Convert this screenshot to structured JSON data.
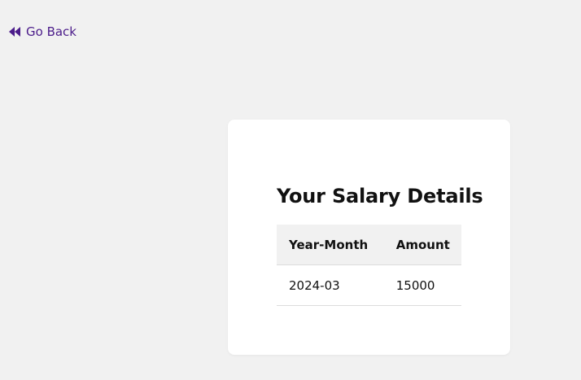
{
  "nav": {
    "go_back_label": "Go Back",
    "go_back_icon": "fast-rewind-icon"
  },
  "card": {
    "title": "Your Salary Details",
    "table": {
      "headers": [
        "Year-Month",
        "Amount"
      ],
      "rows": [
        [
          "2024-03",
          "15000"
        ]
      ]
    }
  },
  "colors": {
    "background": "#f1f1f1",
    "link": "#4b1c8a",
    "card": "#ffffff"
  }
}
